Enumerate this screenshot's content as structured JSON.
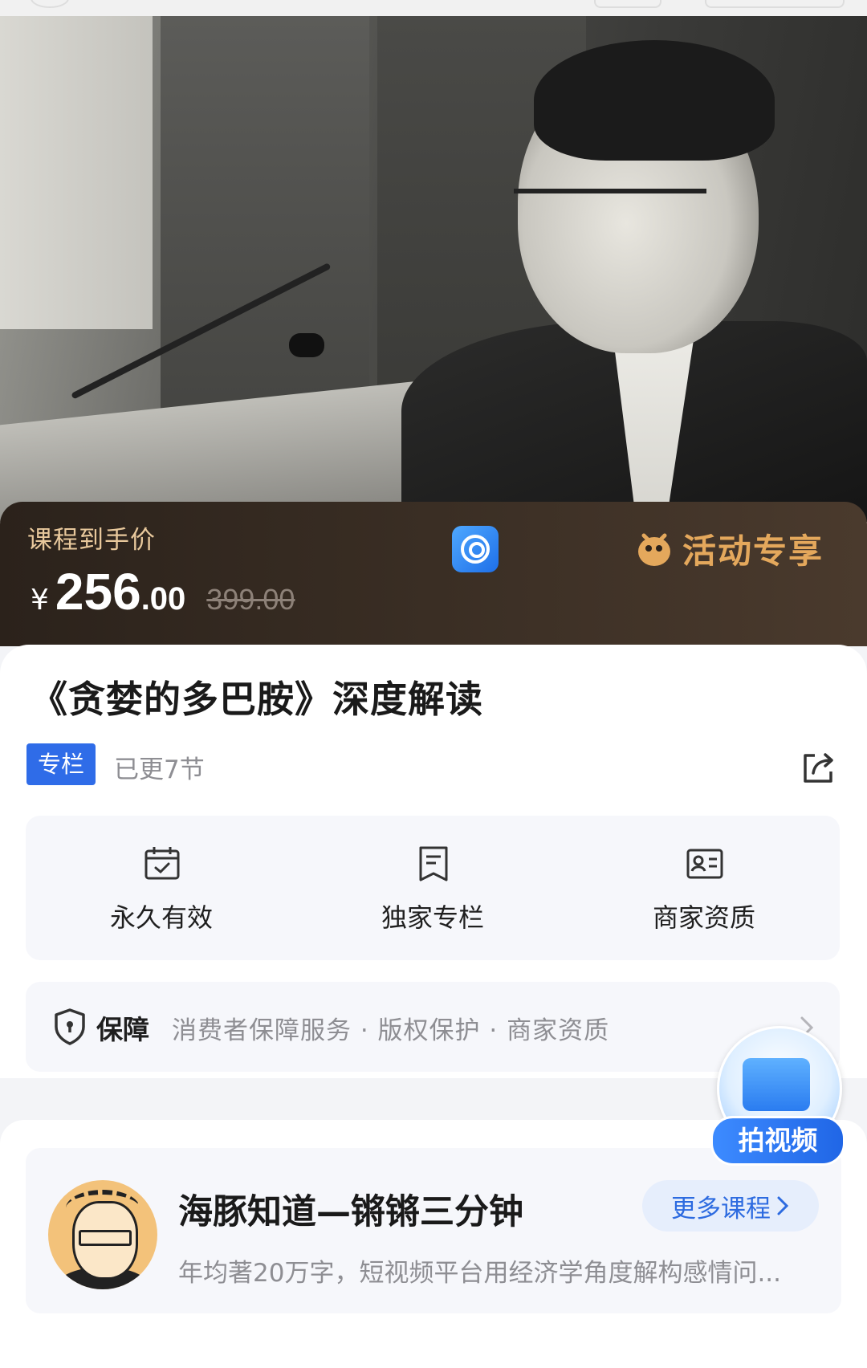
{
  "price": {
    "label": "课程到手价",
    "currency": "¥",
    "integer": "256",
    "decimal": ".00",
    "original": "399.00",
    "promo_label": "活动专享"
  },
  "course": {
    "title": "《贪婪的多巴胺》深度解读",
    "tag": "专栏",
    "updated": "已更7节"
  },
  "features": [
    {
      "label": "永久有效",
      "icon": "calendar-check-icon"
    },
    {
      "label": "独家专栏",
      "icon": "document-icon"
    },
    {
      "label": "商家资质",
      "icon": "id-card-icon"
    }
  ],
  "guarantee": {
    "title": "保障",
    "desc": "消费者保障服务 · 版权保护 · 商家资质"
  },
  "float_button": {
    "label": "拍视频"
  },
  "author": {
    "name": "海豚知道—锵锵三分钟",
    "desc": "年均著20万字，短视频平台用经济学角度解构感情问...",
    "more_label": "更多课程"
  },
  "colors": {
    "accent": "#2f6ce8",
    "price_label": "#e8c89c",
    "promo": "#e4a85c"
  }
}
